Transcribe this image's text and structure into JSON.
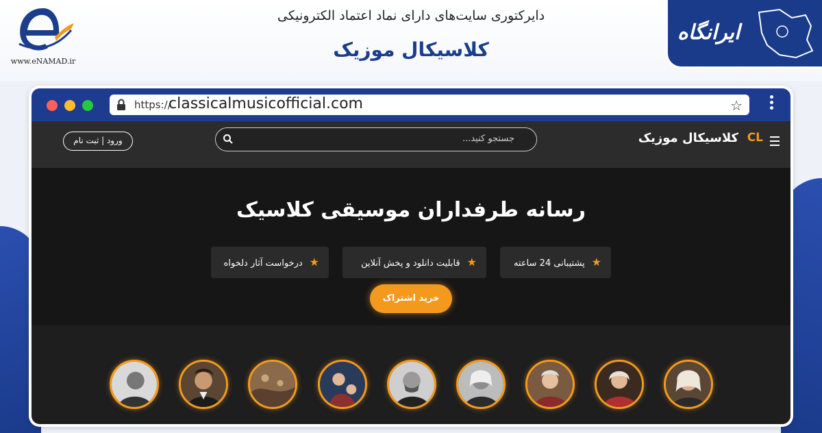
{
  "header": {
    "enamad_label": "www.eNAMAD.ir",
    "directory_text": "دایرکتوری سایت‌های دارای نماد اعتماد الکترونیکی",
    "site_title": "کلاسیکال موزیک",
    "irangah_label": "ایرانگاه"
  },
  "browser": {
    "url_protocol": "https://",
    "url_domain": "classicalmusicofficial.com",
    "bookmark_icon": "star-icon",
    "menu_icon": "kebab-icon"
  },
  "site": {
    "login_label": "ورود | ثبت نام",
    "search_placeholder": "جستجو کنید...",
    "brand_name": "کلاسیکال موزیک",
    "brand_logo": "CL"
  },
  "hero": {
    "title": "رسانه طرفداران موسیقی کلاسیک",
    "features": [
      "پشتیبانی 24 ساعته",
      "قابلیت دانلود و پخش آنلاین",
      "درخواست آثار دلخواه"
    ],
    "subscribe_label": "خرید اشتراک"
  },
  "colors": {
    "accent": "#f39a1e",
    "frame": "#1d3c8f",
    "nav": "#2c2c2c",
    "hero": "#161616"
  }
}
